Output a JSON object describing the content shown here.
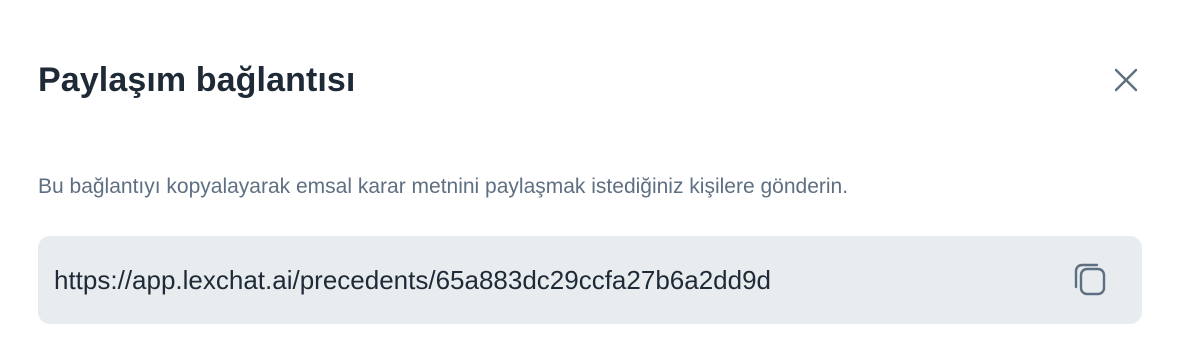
{
  "dialog": {
    "title": "Paylaşım bağlantısı",
    "close_icon": "close-icon",
    "description": "Bu bağlantıyı kopyalayarak emsal karar metnini paylaşmak istediğiniz kişilere gönderin.",
    "share_link": "https://app.lexchat.ai/precedents/65a883dc29ccfa27b6a2dd9d",
    "copy_icon": "copy-icon"
  },
  "colors": {
    "title": "#1f2a37",
    "description": "#5f6f82",
    "link_box_bg": "#e8ecef",
    "icon": "#5f6f82"
  }
}
